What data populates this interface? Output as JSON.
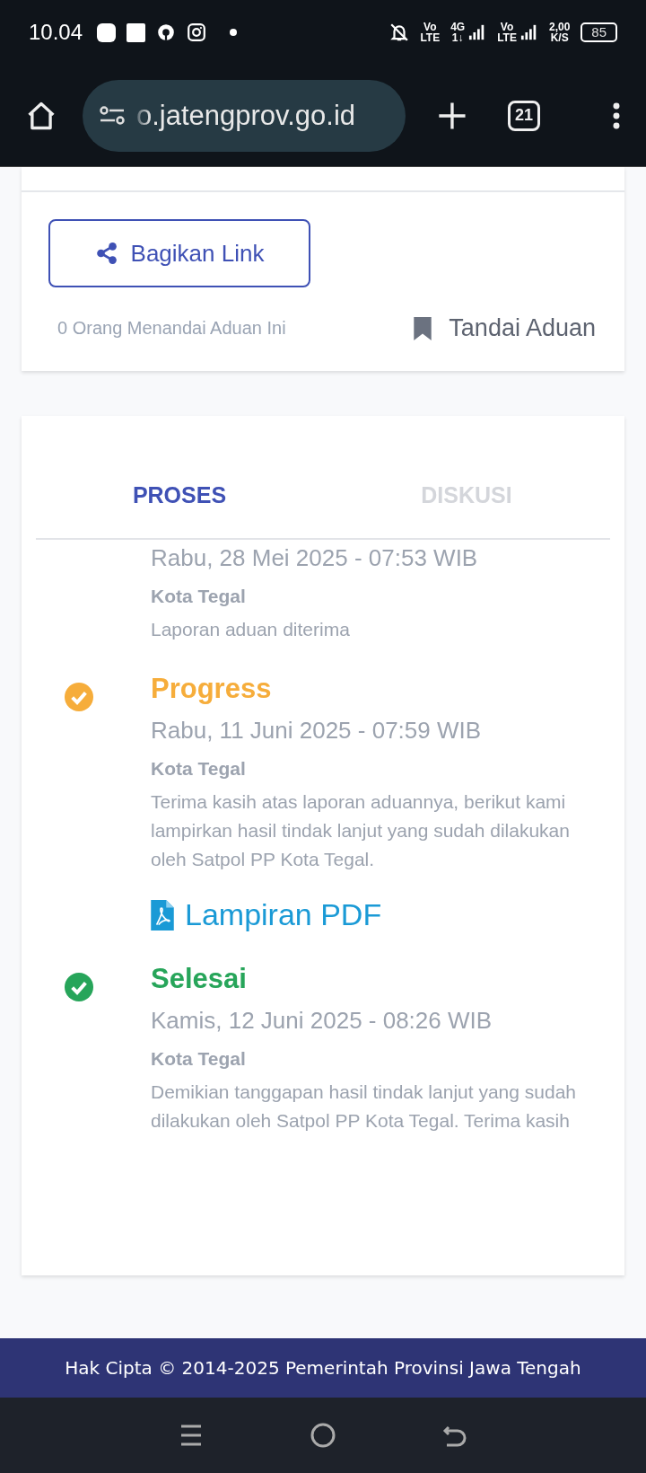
{
  "status_bar": {
    "time": "10.04",
    "network": [
      {
        "top": "Vo",
        "bottom": "LTE"
      },
      {
        "top": "4G",
        "bottom": "1↓"
      },
      {
        "top": "Vo",
        "bottom": "LTE"
      }
    ],
    "speed": {
      "value": "2,00",
      "unit": "K/S"
    },
    "battery": "85"
  },
  "browser": {
    "url": "o.jatengprov.go.id",
    "tab_count": "21"
  },
  "share_card": {
    "share_button": "Bagikan Link",
    "bookmark_count": "0 Orang Menandai Aduan Ini",
    "bookmark_button": "Tandai Aduan"
  },
  "tabs": [
    {
      "label": "PROSES",
      "selected": true
    },
    {
      "label": "DISKUSI",
      "selected": false
    }
  ],
  "timeline": [
    {
      "date": "Rabu, 28 Mei 2025 - 07:53 WIB",
      "location": "Kota Tegal",
      "note": "Laporan aduan diterima"
    },
    {
      "title": "Progress",
      "color": "#f6ad3b",
      "date": "Rabu, 11 Juni 2025 - 07:59 WIB",
      "location": "Kota Tegal",
      "note": "Terima kasih atas laporan aduannya, berikut kami lampirkan hasil tindak lanjut yang sudah dilakukan oleh Satpol PP Kota Tegal.",
      "attachment": "Lampiran PDF"
    },
    {
      "title": "Selesai",
      "color": "#27a55a",
      "date": "Kamis, 12 Juni 2025 - 08:26 WIB",
      "location": "Kota Tegal",
      "note": "Demikian tanggapan hasil tindak lanjut yang sudah dilakukan oleh Satpol PP Kota Tegal. Terima kasih"
    }
  ],
  "footer": "Hak Cipta © 2014-2025 Pemerintah Provinsi Jawa Tengah"
}
